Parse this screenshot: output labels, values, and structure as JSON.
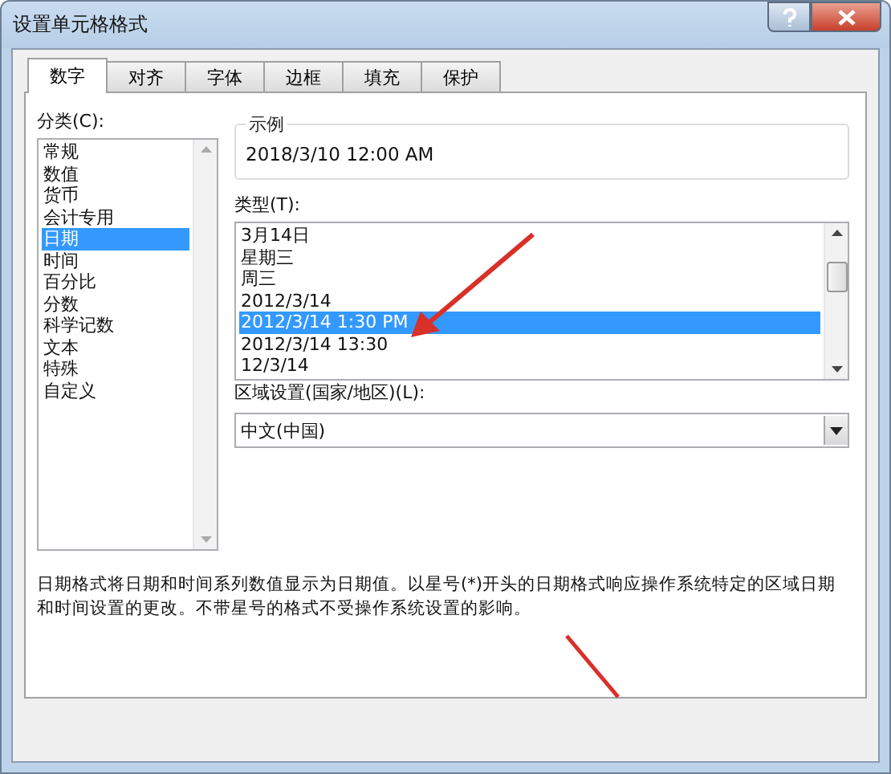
{
  "window": {
    "title": "设置单元格格式"
  },
  "tabs": [
    {
      "label": "数字",
      "selected": true
    },
    {
      "label": "对齐",
      "selected": false
    },
    {
      "label": "字体",
      "selected": false
    },
    {
      "label": "边框",
      "selected": false
    },
    {
      "label": "填充",
      "selected": false
    },
    {
      "label": "保护",
      "selected": false
    }
  ],
  "category": {
    "label": "分类(C):",
    "items": [
      {
        "label": "常规",
        "selected": false
      },
      {
        "label": "数值",
        "selected": false
      },
      {
        "label": "货币",
        "selected": false
      },
      {
        "label": "会计专用",
        "selected": false
      },
      {
        "label": "日期",
        "selected": true
      },
      {
        "label": "时间",
        "selected": false
      },
      {
        "label": "百分比",
        "selected": false
      },
      {
        "label": "分数",
        "selected": false
      },
      {
        "label": "科学记数",
        "selected": false
      },
      {
        "label": "文本",
        "selected": false
      },
      {
        "label": "特殊",
        "selected": false
      },
      {
        "label": "自定义",
        "selected": false
      }
    ]
  },
  "sample": {
    "title": "示例",
    "value": "2018/3/10 12:00 AM"
  },
  "type": {
    "label": "类型(T):",
    "items": [
      {
        "label": "3月14日",
        "selected": false
      },
      {
        "label": "星期三",
        "selected": false
      },
      {
        "label": "周三",
        "selected": false
      },
      {
        "label": "2012/3/14",
        "selected": false
      },
      {
        "label": "2012/3/14 1:30 PM",
        "selected": true
      },
      {
        "label": "2012/3/14 13:30",
        "selected": false
      },
      {
        "label": "12/3/14",
        "selected": false
      }
    ]
  },
  "locale": {
    "label": "区域设置(国家/地区)(L):",
    "value": "中文(中国)"
  },
  "description": "日期格式将日期和时间系列数值显示为日期值。以星号(*)开头的日期格式响应操作系统特定的区域日期和时间设置的更改。不带星号的格式不受操作系统设置的影响。"
}
